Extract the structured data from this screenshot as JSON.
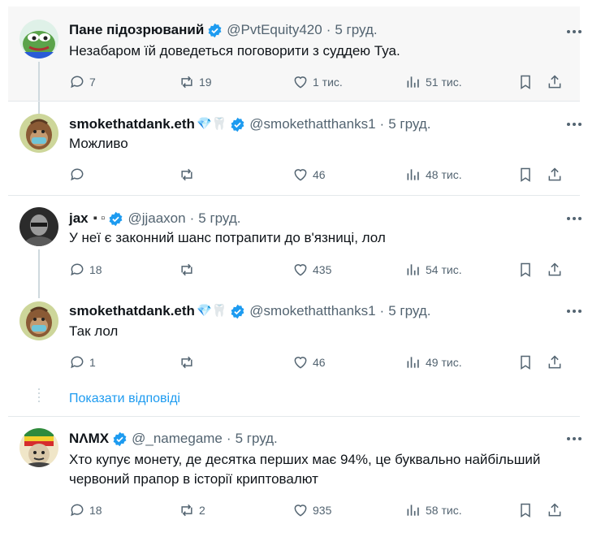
{
  "tweets": [
    {
      "name": "Пане підозрюваний",
      "handle": "@PvtEquity420",
      "dot": "·",
      "date": "5 груд.",
      "text": "Незабаром їй доведеться поговорити з суддею Туа.",
      "replies": "7",
      "retweets": "19",
      "likes": "1 тис.",
      "views": "51 тис.",
      "avatar_icon": "pepe-frog-avatar"
    },
    {
      "name": "smokethatdank.eth",
      "emojis": "💎🦷",
      "handle": "@smokethatthanks1",
      "dot": "·",
      "date": "5 груд.",
      "text": "Можливо",
      "replies": "",
      "retweets": "",
      "likes": "46",
      "views": "48 тис.",
      "avatar_icon": "ape-avatar"
    },
    {
      "name": "jax",
      "emojis": "▪ ▫",
      "handle": "@jjaaxon",
      "dot": "·",
      "date": "5 груд.",
      "text": "У неї є законний шанс потрапити до в'язниці, лол",
      "replies": "18",
      "retweets": "",
      "likes": "435",
      "views": "54 тис.",
      "avatar_icon": "photo-avatar"
    },
    {
      "name": "smokethatdank.eth",
      "emojis": "💎🦷",
      "handle": "@smokethatthanks1",
      "dot": "·",
      "date": "5 груд.",
      "text": "Так лол",
      "replies": "1",
      "retweets": "",
      "likes": "46",
      "views": "49 тис.",
      "avatar_icon": "ape-avatar"
    },
    {
      "name": "NΛMX",
      "handle": "@_namegame",
      "dot": "·",
      "date": "5 груд.",
      "text_line1": "Хто купує монету, де десятка перших має 94%, це буквально найбільший",
      "text_line2": "червоний прапор в історії криптовалют",
      "replies": "18",
      "retweets": "2",
      "likes": "935",
      "views": "58 тис.",
      "avatar_icon": "cartoon-avatar"
    }
  ],
  "show_replies": "Показати відповіді",
  "colors": {
    "accent": "#1d9bf0",
    "secondary_text": "#536471",
    "divider": "#e4e8eb"
  }
}
